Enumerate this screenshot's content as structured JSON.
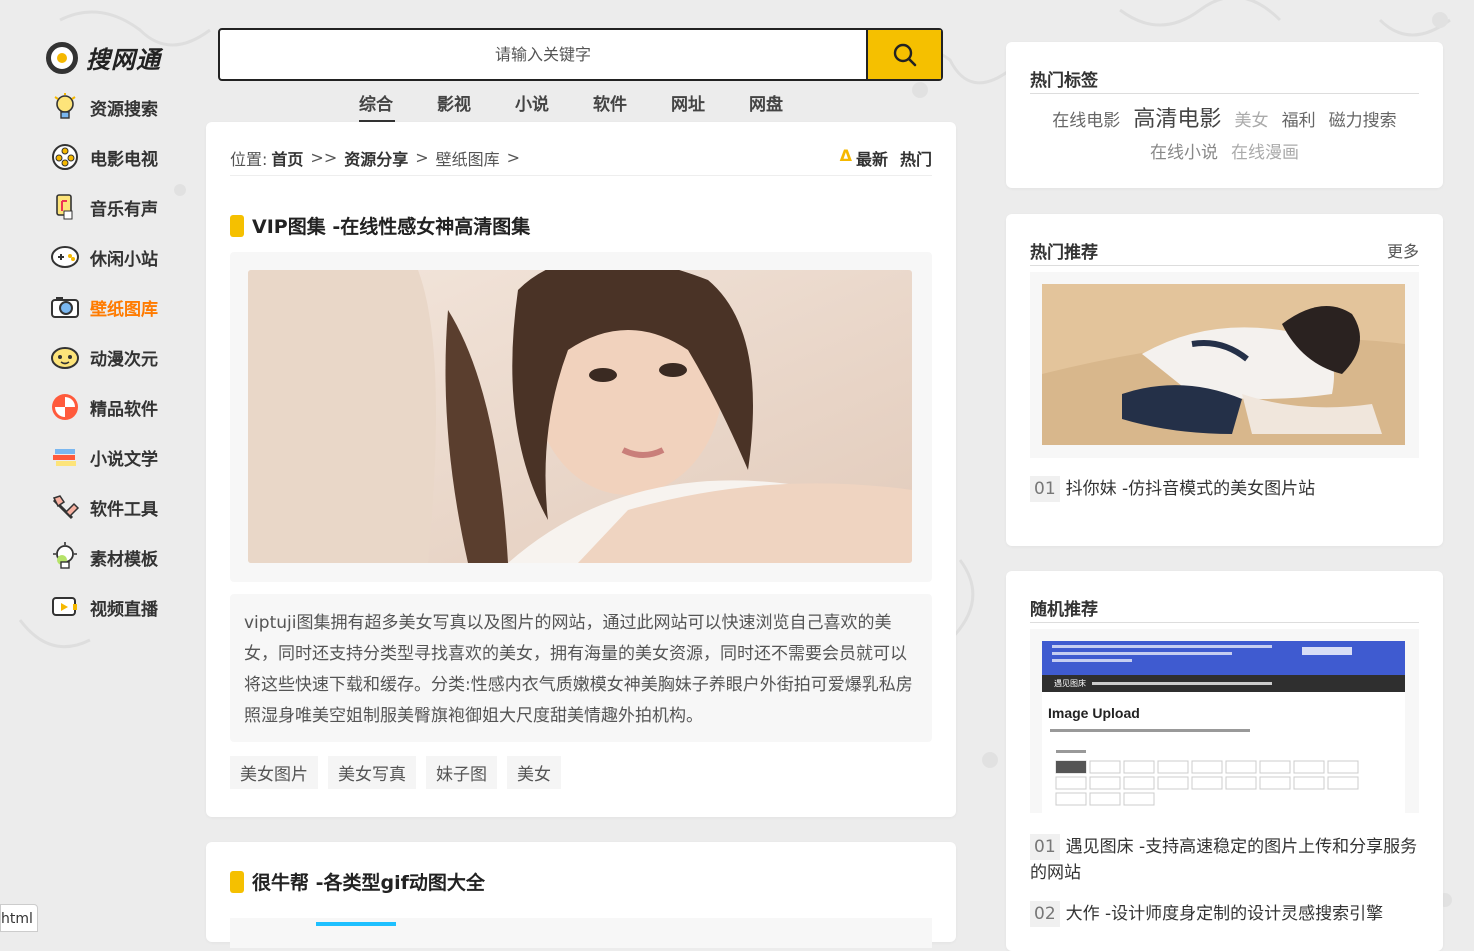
{
  "logo": {
    "text": "搜网通"
  },
  "sidebar": {
    "items": [
      {
        "label": "资源搜索",
        "icon": "lightbulb-icon"
      },
      {
        "label": "电影电视",
        "icon": "film-reel-icon"
      },
      {
        "label": "音乐有声",
        "icon": "music-icon"
      },
      {
        "label": "休闲小站",
        "icon": "gamepad-icon"
      },
      {
        "label": "壁纸图库",
        "icon": "camera-icon",
        "active": true
      },
      {
        "label": "动漫次元",
        "icon": "anime-icon"
      },
      {
        "label": "精品软件",
        "icon": "app-icon"
      },
      {
        "label": "小说文学",
        "icon": "books-icon"
      },
      {
        "label": "软件工具",
        "icon": "tools-icon"
      },
      {
        "label": "素材模板",
        "icon": "bulb-template-icon"
      },
      {
        "label": "视频直播",
        "icon": "video-icon"
      }
    ]
  },
  "search": {
    "placeholder": "请输入关键字"
  },
  "tabs": [
    {
      "label": "综合",
      "active": true
    },
    {
      "label": "影视"
    },
    {
      "label": "小说"
    },
    {
      "label": "软件"
    },
    {
      "label": "网址"
    },
    {
      "label": "网盘"
    }
  ],
  "breadcrumb": {
    "prefix": "位置:",
    "home": "首页",
    "sep1": ">>",
    "section": "资源分享",
    "sep2": ">",
    "category": "壁纸图库",
    "sep3": ">",
    "sort_marker": "Δ",
    "sort_new": "最新",
    "sort_hot": "热门"
  },
  "post1": {
    "title": "VIP图集 -在线性感女神高清图集",
    "description": "viptuji图集拥有超多美女写真以及图片的网站，通过此网站可以快速浏览自己喜欢的美女，同时还支持分类型寻找喜欢的美女，拥有海量的美女资源，同时还不需要会员就可以将这些快速下载和缓存。分类:性感内衣气质嫩模女神美胸妹子养眼户外街拍可爱爆乳私房照湿身唯美空姐制服美臀旗袍御姐大尺度甜美情趣外拍机构。",
    "tags": [
      "美女图片",
      "美女写真",
      "妹子图",
      "美女"
    ]
  },
  "post2": {
    "title": "很牛帮 -各类型gif动图大全"
  },
  "hot_tags": {
    "heading": "热门标签",
    "tags": [
      "在线电影",
      "高清电影",
      "美女",
      "福利",
      "磁力搜索",
      "在线小说",
      "在线漫画"
    ]
  },
  "hot_recommend": {
    "heading": "热门推荐",
    "more": "更多",
    "items": [
      {
        "num": "01",
        "title": "抖你妹 -仿抖音模式的美女图片站"
      }
    ]
  },
  "random_recommend": {
    "heading": "随机推荐",
    "preview": {
      "title": "Image Upload",
      "nav": "遇见图床"
    },
    "items": [
      {
        "num": "01",
        "title": "遇见图床 -支持高速稳定的图片上传和分享服务的网站"
      },
      {
        "num": "02",
        "title": "大作 -设计师度身定制的设计灵感搜索引擎"
      }
    ]
  },
  "footer_tag": "html",
  "colors": {
    "accent": "#f5c000",
    "active_nav": "#ff7b00"
  }
}
